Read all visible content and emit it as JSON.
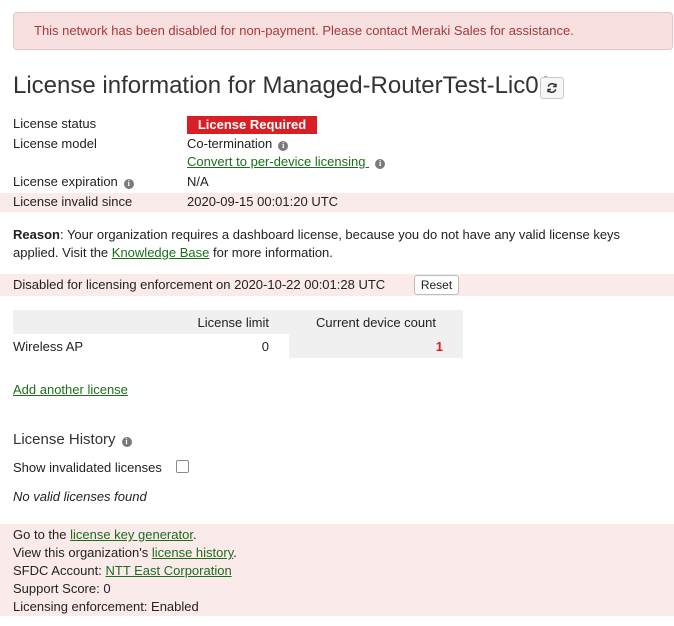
{
  "alert": {
    "text": "This network has been disabled for non-payment. Please contact Meraki Sales for assistance."
  },
  "title": "License information for Managed-RouterTest-Lic01",
  "license": {
    "status_label": "License status",
    "status_badge": "License Required",
    "model_label": "License model",
    "model_value": "Co-termination",
    "convert_link": "Convert to per-device licensing ",
    "expiration_label": "License expiration",
    "expiration_value": "N/A",
    "invalid_label": "License invalid since",
    "invalid_value": "2020-09-15 00:01:20 UTC"
  },
  "reason": {
    "bold": "Reason",
    "text_before": ": Your organization requires a dashboard license, because you do not have any valid license keys applied. Visit the ",
    "link": "Knowledge Base",
    "text_after": " for more information."
  },
  "enforcement": {
    "text": "Disabled for licensing enforcement on 2020-10-22 00:01:28 UTC",
    "reset_label": "Reset"
  },
  "license_table": {
    "headers": [
      "",
      "License limit",
      "Current device count"
    ],
    "rows": [
      {
        "type": "Wireless AP",
        "limit": "0",
        "count": "1"
      }
    ]
  },
  "add_license_link": "Add another license",
  "history": {
    "title": "License History",
    "show_invalidated_label": "Show invalidated licenses",
    "show_invalidated_checked": false,
    "empty_text": "No valid licenses found"
  },
  "footer": {
    "keygen_prefix": "Go to the ",
    "keygen_link": "license key generator",
    "keygen_suffix": ".",
    "history_prefix": "View this organization's ",
    "history_link": "license history",
    "history_suffix": ".",
    "sfdc_prefix": "SFDC Account: ",
    "sfdc_link": "NTT East Corporation",
    "support_score": "Support Score: 0",
    "enforcement_status": "Licensing enforcement: Enabled"
  },
  "colors": {
    "alert_bg": "#f8e0e0",
    "alert_text": "#a33a3a",
    "badge_bg": "#d81f26",
    "link": "#1c6e1c",
    "highlight_bg": "#fbeaea"
  },
  "icons": {
    "refresh": "refresh-icon",
    "info": "info-icon"
  }
}
